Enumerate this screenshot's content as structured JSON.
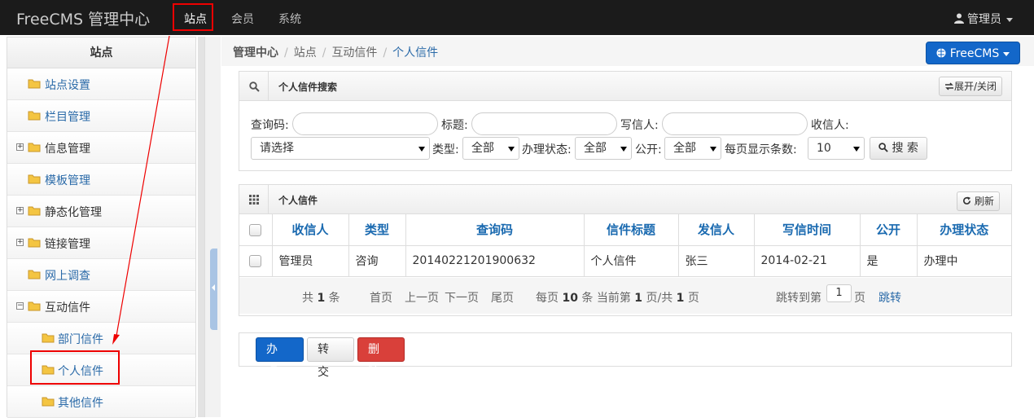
{
  "navbar": {
    "brand": "FreeCMS 管理中心",
    "items": [
      {
        "label": "站点"
      },
      {
        "label": "会员"
      },
      {
        "label": "系统"
      }
    ],
    "user": "管理员"
  },
  "sidebar": {
    "title": "站点",
    "items": [
      {
        "label": "站点设置",
        "expander": ""
      },
      {
        "label": "栏目管理",
        "expander": ""
      },
      {
        "label": "信息管理",
        "expander": "+"
      },
      {
        "label": "模板管理",
        "expander": ""
      },
      {
        "label": "静态化管理",
        "expander": "+"
      },
      {
        "label": "链接管理",
        "expander": "+"
      },
      {
        "label": "网上调查",
        "expander": ""
      },
      {
        "label": "互动信件",
        "expander": "−"
      },
      {
        "label": "部门信件",
        "expander": ""
      },
      {
        "label": "个人信件",
        "expander": ""
      },
      {
        "label": "其他信件",
        "expander": ""
      }
    ]
  },
  "breadcrumb": {
    "items": [
      "管理中心",
      "站点",
      "互动信件",
      "个人信件"
    ]
  },
  "freecms_button": "FreeCMS",
  "search_panel": {
    "title": "个人信件搜索",
    "toggle_label": "展开/关闭",
    "labels": {
      "query_code": "查询码:",
      "title": "标题:",
      "writer": "写信人:",
      "receiver": "收信人:",
      "type": "类型:",
      "status": "办理状态:",
      "public": "公开:",
      "page_size": "每页显示条数:"
    },
    "receiver_select": "请选择",
    "type_select": "全部",
    "status_select": "全部",
    "public_select": "全部",
    "page_size_select": "10",
    "search_button": "搜 索"
  },
  "list_panel": {
    "title": "个人信件",
    "refresh_label": "刷新",
    "columns": [
      "收信人",
      "类型",
      "查询码",
      "信件标题",
      "发信人",
      "写信时间",
      "公开",
      "办理状态"
    ],
    "rows": [
      [
        "管理员",
        "咨询",
        "20140221201900632",
        "个人信件",
        "张三",
        "2014-02-21",
        "是",
        "办理中"
      ]
    ],
    "pager": {
      "total_prefix": "共",
      "total": "1",
      "total_suffix": "条",
      "first": "首页",
      "prev": "上一页",
      "next": "下一页",
      "last": "尾页",
      "per_prefix": "每页",
      "per": "10",
      "per_mid": "条 当前第",
      "cur": "1",
      "cur_mid": "页/共",
      "pages": "1",
      "pages_suffix": "页",
      "jump_prefix": "跳转到第",
      "jump_value": "1",
      "jump_suffix": "页",
      "jump": "跳转"
    }
  },
  "actions": {
    "handle": "办理",
    "transfer": "转交",
    "delete": "删除"
  },
  "colors": {
    "primary": "#1367c9",
    "danger": "#d9403a",
    "link": "#2a6aa8",
    "highlight": "#e00000"
  }
}
